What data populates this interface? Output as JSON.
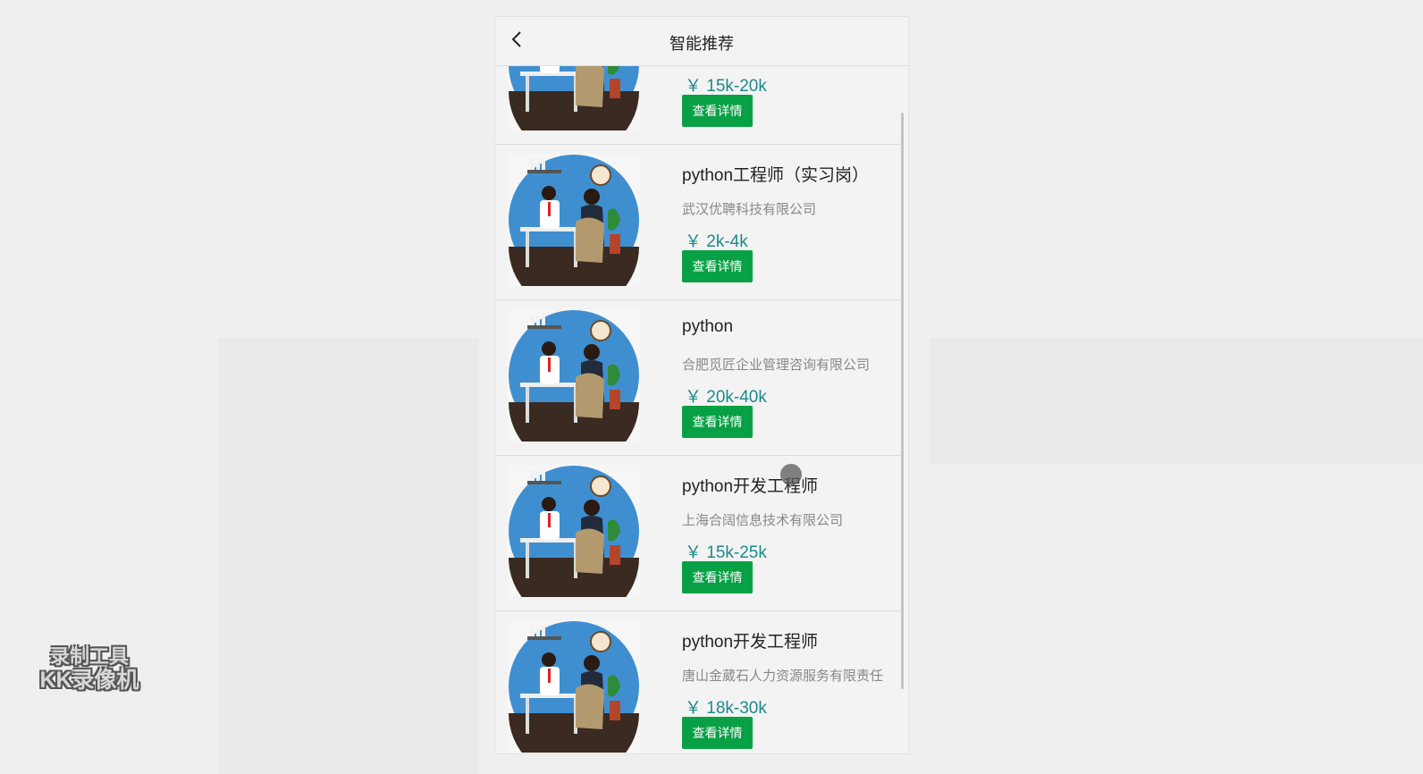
{
  "header": {
    "title": "智能推荐",
    "back_icon": "chevron-left-icon"
  },
  "jobs": [
    {
      "title": "",
      "company": "",
      "salary": "￥ 15k-20k",
      "button": "查看详情"
    },
    {
      "title": "python工程师（实习岗）",
      "company": "武汉优聘科技有限公司",
      "salary": "￥ 2k-4k",
      "button": "查看详情"
    },
    {
      "title": "python",
      "company": "合肥觅匠企业管理咨询有限公司",
      "salary": "￥ 20k-40k",
      "button": "查看详情"
    },
    {
      "title": "python开发工程师",
      "company": "上海合阔信息技术有限公司",
      "salary": "￥ 15k-25k",
      "button": "查看详情"
    },
    {
      "title": "python开发工程师",
      "company": "唐山金葳石人力资源服务有限责任",
      "salary": "￥ 18k-30k",
      "button": "查看详情"
    }
  ],
  "colors": {
    "accent_button": "#08a045",
    "salary_text": "#1d8a8a"
  },
  "watermark": {
    "line1": "录制工具",
    "line2": "KK录像机"
  }
}
